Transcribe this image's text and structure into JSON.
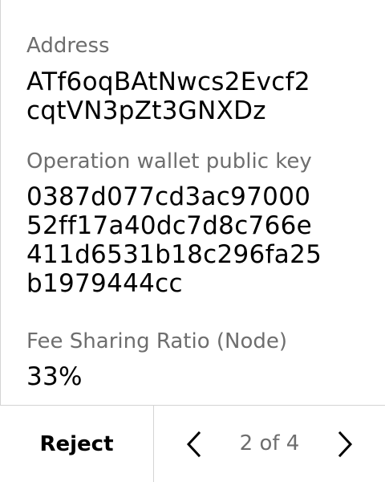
{
  "fields": {
    "address": {
      "label": "Address",
      "lines": [
        "ATf6oqBAtNwcs2Evcf2",
        "cqtVN3pZt3GNXDz"
      ]
    },
    "operation_key": {
      "label": "Operation wallet public key",
      "lines": [
        "0387d077cd3ac97000",
        "52ff17a40dc7d8c766e",
        "411d6531b18c296fa25",
        "b1979444cc"
      ]
    },
    "fee_ratio": {
      "label": "Fee Sharing Ratio (Node)",
      "value": "33%"
    }
  },
  "footer": {
    "reject_label": "Reject",
    "page_indicator": "2 of 4",
    "prev_icon": "chevron-left-icon",
    "next_icon": "chevron-right-icon"
  },
  "colors": {
    "label": "#6e6e6e",
    "value": "#000000",
    "divider": "#d4d4d4",
    "background": "#ffffff"
  }
}
